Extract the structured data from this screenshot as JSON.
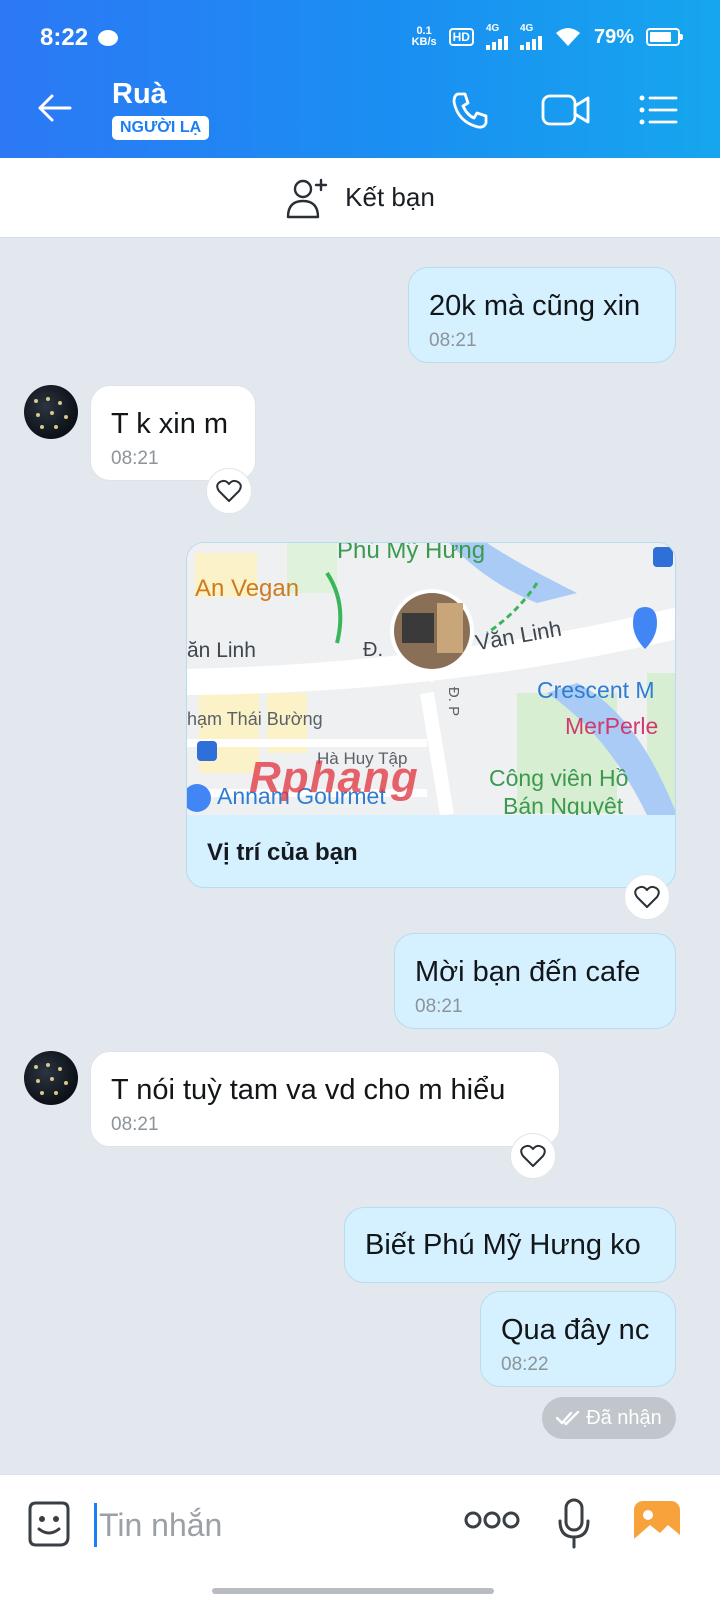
{
  "status_bar": {
    "time": "8:22",
    "net_speed_value": "0.1",
    "net_speed_unit": "KB/s",
    "hd_label": "HD",
    "sim1_label": "4G",
    "sim2_label": "4G",
    "battery_percent": "79%",
    "battery_level": 0.79
  },
  "header": {
    "title": "Ruà",
    "badge": "NGƯỜI LẠ",
    "icons": [
      "back-arrow-icon",
      "phone-icon",
      "video-call-icon",
      "menu-list-icon"
    ]
  },
  "add_friend": {
    "label": "Kết bạn",
    "icon": "add-user-icon"
  },
  "messages": [
    {
      "side": "me",
      "text": "20k mà cũng xin",
      "time": "08:21"
    },
    {
      "side": "them",
      "text": "T k xin m",
      "time": "08:21"
    },
    {
      "side": "me",
      "type": "location",
      "caption": "Vị trí của bạn"
    },
    {
      "side": "me",
      "text": "Mời bạn đến cafe",
      "time": "08:21"
    },
    {
      "side": "them",
      "text": "T nói tuỳ tam va vd cho m hiểu",
      "time": "08:21"
    },
    {
      "side": "me",
      "text": "Biết Phú Mỹ Hưng ko"
    },
    {
      "side": "me",
      "text": "Qua đây nc",
      "time": "08:22"
    }
  ],
  "map_labels": {
    "top": "Phú Mỹ Hưng",
    "vegan": "An Vegan",
    "linh_left": "ăn Linh",
    "street": "Đ.",
    "van_linh": "Văn Linh",
    "crescent": "Crescent M",
    "merperle": "MerPerle",
    "thai_buong": "hạm Thái Bường",
    "ha_huy_tap": "Hà Huy Tập",
    "cong_vien": "Công viên Hồ",
    "ban_nguyet": "Bán Nguyệt",
    "annam": "Annam Gourmet",
    "road_vertical": "Đ. P",
    "watermark": "Rphang"
  },
  "seen_status": "Đã nhận",
  "composer": {
    "placeholder": "Tin nhắn",
    "icons": [
      "emoji-icon",
      "more-dots-icon",
      "microphone-icon",
      "image-icon"
    ]
  },
  "colors": {
    "header_start": "#2c78f5",
    "header_end": "#16a6ee",
    "my_bubble": "#d5f1ff",
    "their_bubble": "#ffffff",
    "background": "#e3e8ee",
    "accent": "#1a7ff2"
  }
}
